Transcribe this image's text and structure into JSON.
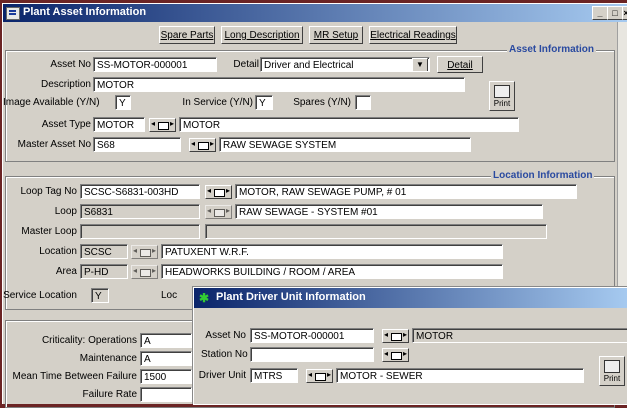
{
  "window": {
    "title": "Plant Asset Information",
    "controls": [
      "_",
      "□",
      "×"
    ]
  },
  "toolbar": {
    "spare_parts": "Spare Parts",
    "long_description": "Long Description",
    "mr_setup": "MR Setup",
    "electrical_readings": "Electrical Readings"
  },
  "asset": {
    "section_title": "Asset Information",
    "asset_no_label": "Asset No",
    "asset_no": "SS-MOTOR-000001",
    "detail_label": "Detail",
    "detail_value": "Driver and Electrical",
    "detail_button": "Detail",
    "description_label": "Description",
    "description": "MOTOR",
    "image_available_label": "Image Available (Y/N)",
    "image_available": "Y",
    "in_service_label": "In Service (Y/N)",
    "in_service": "Y",
    "spares_label": "Spares (Y/N)",
    "spares": "",
    "asset_type_label": "Asset Type",
    "asset_type": "MOTOR",
    "asset_type_desc": "MOTOR",
    "master_asset_label": "Master Asset No",
    "master_asset": "S68",
    "master_asset_desc": "RAW SEWAGE SYSTEM",
    "print_label": "Print"
  },
  "location": {
    "section_title": "Location Information",
    "loop_tag_label": "Loop Tag No",
    "loop_tag": "SCSC-S6831-003HD",
    "loop_tag_desc": "MOTOR, RAW SEWAGE PUMP, # 01",
    "loop_label": "Loop",
    "loop": "S6831",
    "loop_desc": "RAW SEWAGE - SYSTEM #01",
    "master_loop_label": "Master Loop",
    "master_loop": "",
    "location_label": "Location",
    "location": "SCSC",
    "location_desc": "PATUXENT W.R.F.",
    "area_label": "Area",
    "area": "P-HD",
    "area_desc": "HEADWORKS BUILDING / ROOM / AREA",
    "service_location_label": "Service Location",
    "service_location": "Y",
    "loc_label": "Loc"
  },
  "criticality": {
    "label": "Criticality:",
    "operations_label": "Operations",
    "operations": "A",
    "maintenance_label": "Maintenance",
    "maintenance": "A",
    "mtbf_label": "Mean Time Between Failure",
    "mtbf": "1500",
    "failure_rate_label": "Failure Rate",
    "failure_rate": ""
  },
  "driver_unit": {
    "title": "Plant Driver Unit Information",
    "asset_no_label": "Asset No",
    "asset_no": "SS-MOTOR-000001",
    "asset_desc": "MOTOR",
    "station_no_label": "Station No",
    "station_no": "",
    "driver_unit_label": "Driver Unit",
    "driver_unit": "MTRS",
    "driver_unit_desc": "MOTOR - SEWER",
    "print_label": "Print"
  }
}
